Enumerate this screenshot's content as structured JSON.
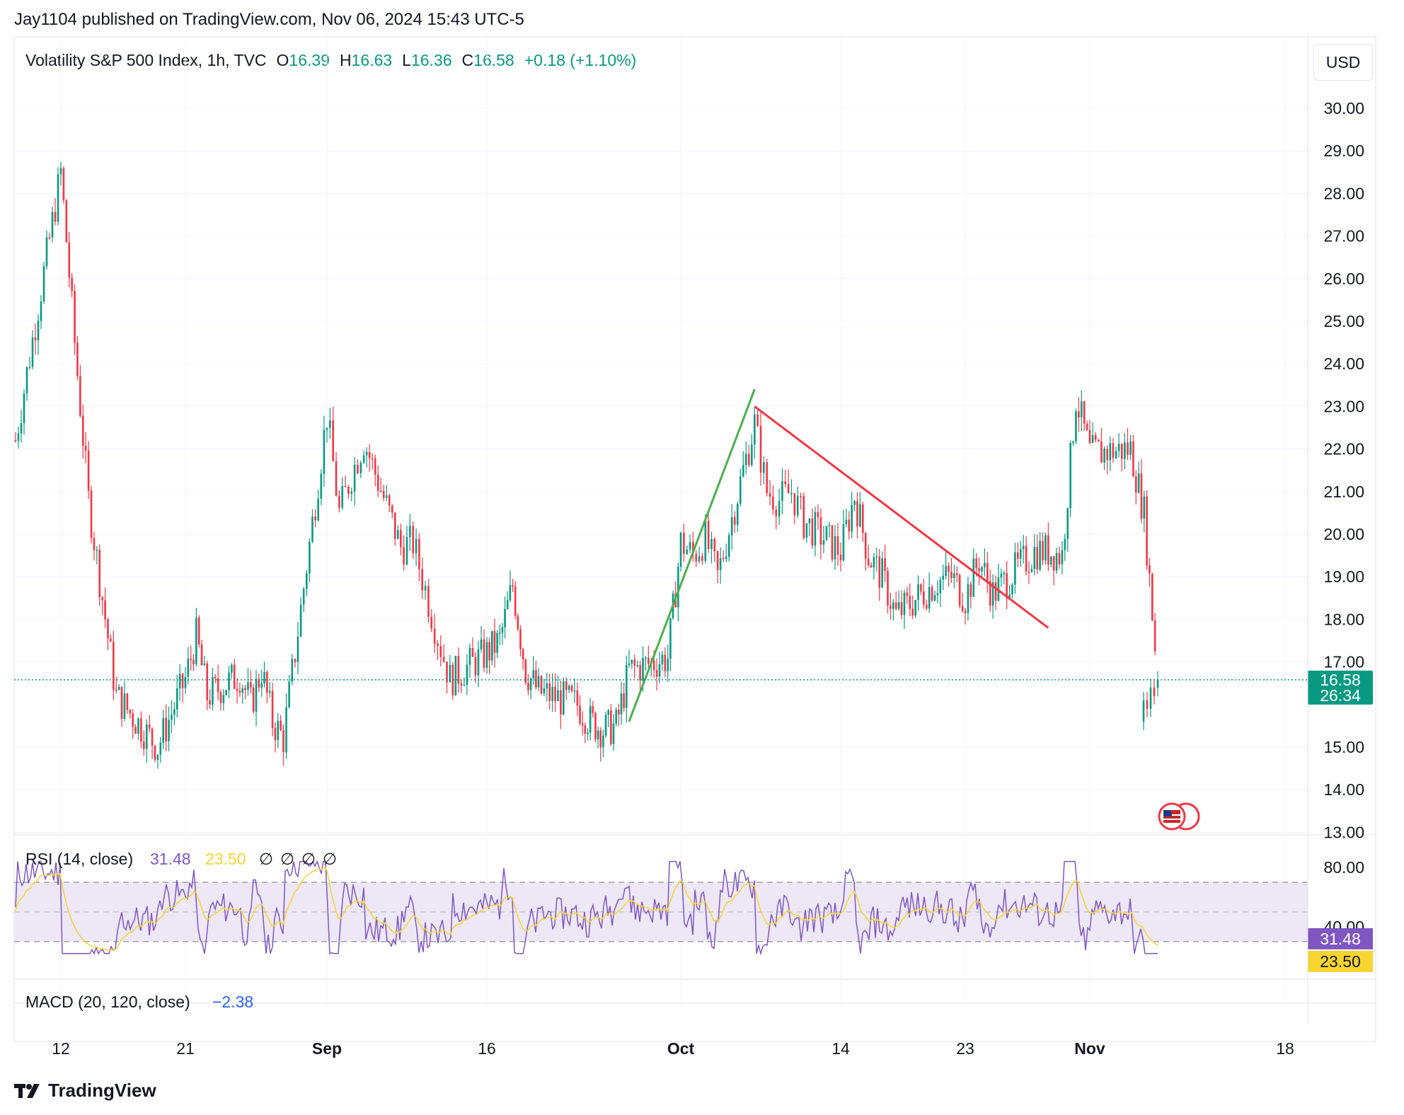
{
  "header": {
    "title": "Jay1104 published on TradingView.com, Nov 06, 2024 15:43 UTC-5"
  },
  "legend": {
    "symbol": "Volatility S&P 500 Index, 1h, TVC",
    "o_label": "O",
    "o_value": "16.39",
    "h_label": "H",
    "h_value": "16.63",
    "l_label": "L",
    "l_value": "16.36",
    "c_label": "C",
    "c_value": "16.58",
    "change": "+0.18 (+1.10%)"
  },
  "currency_button": "USD",
  "price_tag": {
    "price": "16.58",
    "countdown": "26:34"
  },
  "rsi": {
    "label": "RSI (14, close)",
    "value": "31.48",
    "ma_value": "23.50",
    "empty_markers": [
      "∅",
      "∅",
      "∅",
      "∅"
    ],
    "tag_value": "31.48",
    "tag_ma": "23.50",
    "axis_ticks": [
      "80.00",
      "40.00"
    ]
  },
  "macd": {
    "label": "MACD (20, 120, close)",
    "value": "−2.38"
  },
  "footer": {
    "brand": "TradingView"
  },
  "colors": {
    "up": "#089981",
    "down": "#f23645",
    "rsi": "#7e57c2",
    "rsi_ma": "#f7d430",
    "uptrend_line": "#4caf50",
    "downtrend_line": "#f23645",
    "rsi_band": "#ede7f6"
  },
  "chart_data": {
    "type": "line",
    "title": "",
    "xlabel": "",
    "ylabel": "",
    "y_ticks": [
      "30.00",
      "29.00",
      "28.00",
      "27.00",
      "26.00",
      "25.00",
      "24.00",
      "23.00",
      "22.00",
      "21.00",
      "20.00",
      "19.00",
      "18.00",
      "17.00",
      "15.00",
      "14.00",
      "13.00"
    ],
    "x_ticks": [
      "12",
      "21",
      "Sep",
      "16",
      "Oct",
      "14",
      "23",
      "Nov",
      "18"
    ],
    "ylim": [
      13,
      30.2
    ],
    "series": [
      {
        "x": [
          "Aug 09",
          "Aug 12",
          "Aug 13",
          "Aug 14",
          "Aug 15",
          "Aug 16",
          "Aug 19",
          "Aug 20",
          "Aug 21",
          "Aug 22",
          "Aug 23",
          "Aug 26",
          "Aug 27",
          "Aug 28",
          "Aug 29",
          "Aug 30",
          "Sep 03",
          "Sep 04",
          "Sep 05",
          "Sep 06",
          "Sep 09",
          "Sep 10",
          "Sep 11",
          "Sep 12",
          "Sep 13",
          "Sep 16",
          "Sep 17",
          "Sep 18",
          "Sep 19",
          "Sep 20",
          "Sep 23",
          "Sep 24",
          "Sep 25",
          "Sep 26",
          "Sep 27",
          "Sep 30",
          "Oct 01",
          "Oct 02",
          "Oct 03",
          "Oct 04",
          "Oct 07",
          "Oct 08",
          "Oct 09",
          "Oct 10",
          "Oct 11",
          "Oct 14",
          "Oct 15",
          "Oct 16",
          "Oct 17",
          "Oct 18",
          "Oct 21",
          "Oct 22",
          "Oct 23",
          "Oct 24",
          "Oct 25",
          "Oct 28",
          "Oct 29",
          "Oct 30",
          "Oct 31",
          "Nov 01",
          "Nov 04",
          "Nov 05",
          "Nov 06"
        ],
        "values": [
          22.2,
          28.5,
          24.5,
          20.8,
          18.5,
          16.2,
          15.0,
          15.8,
          16.6,
          17.6,
          16.2,
          16.7,
          16.0,
          16.8,
          15.6,
          15.2,
          22.8,
          20.5,
          21.4,
          22.2,
          19.7,
          19.8,
          18.7,
          17.6,
          16.6,
          17.2,
          17.5,
          18.8,
          16.8,
          16.3,
          16.0,
          15.6,
          15.4,
          15.5,
          16.8,
          17.1,
          19.8,
          19.5,
          19.9,
          19.0,
          22.6,
          21.0,
          20.8,
          21.0,
          20.3,
          19.6,
          20.9,
          19.5,
          19.0,
          18.1,
          18.9,
          19.0,
          18.5,
          19.4,
          18.6,
          19.6,
          19.6,
          19.5,
          23.2,
          21.9,
          22.0,
          20.5,
          16.58
        ]
      }
    ],
    "trendlines": [
      {
        "color": "uptrend",
        "from": [
          "Sep 27",
          15.6
        ],
        "to": [
          "Oct 07",
          23.4
        ]
      },
      {
        "color": "downtrend",
        "from": [
          "Oct 07",
          23.0
        ],
        "to": [
          "Oct 29",
          17.8
        ]
      }
    ],
    "last_price": 16.58,
    "rsi_range": [
      20,
      90
    ],
    "rsi_bands": [
      30,
      70
    ],
    "rsi_midline": 50
  }
}
